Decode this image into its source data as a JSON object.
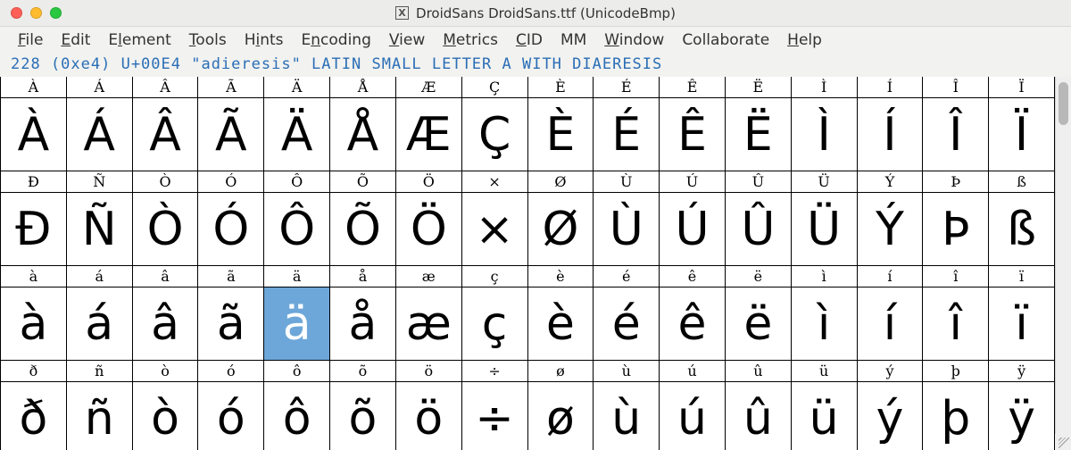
{
  "titlebar": {
    "icon_label": "X",
    "title": "DroidSans  DroidSans.ttf (UnicodeBmp)"
  },
  "menu": {
    "items": [
      {
        "label": "File",
        "u": 0
      },
      {
        "label": "Edit",
        "u": 0
      },
      {
        "label": "Element",
        "u": 1
      },
      {
        "label": "Tools",
        "u": 0
      },
      {
        "label": "Hints",
        "u": 1
      },
      {
        "label": "Encoding",
        "u": 1
      },
      {
        "label": "View",
        "u": 0
      },
      {
        "label": "Metrics",
        "u": 0
      },
      {
        "label": "CID",
        "u": 0
      },
      {
        "label": "MM",
        "u": -1
      },
      {
        "label": "Window",
        "u": 0
      },
      {
        "label": "Collaborate",
        "u": -1
      },
      {
        "label": "Help",
        "u": 0
      }
    ]
  },
  "status": "228 (0xe4) U+00E4 \"adieresis\" LATIN SMALL LETTER A WITH DIAERESIS",
  "glyph_rows": [
    {
      "labels": [
        "À",
        "Á",
        "Â",
        "Ã",
        "Ä",
        "Å",
        "Æ",
        "Ç",
        "È",
        "É",
        "Ê",
        "Ë",
        "Ì",
        "Í",
        "Î",
        "Ï"
      ],
      "glyphs": [
        "À",
        "Á",
        "Â",
        "Ã",
        "Ä",
        "Å",
        "Æ",
        "Ç",
        "È",
        "É",
        "Ê",
        "Ë",
        "Ì",
        "Í",
        "Î",
        "Ï"
      ]
    },
    {
      "labels": [
        "Ð",
        "Ñ",
        "Ò",
        "Ó",
        "Ô",
        "Õ",
        "Ö",
        "×",
        "Ø",
        "Ù",
        "Ú",
        "Û",
        "Ü",
        "Ý",
        "Þ",
        "ß"
      ],
      "glyphs": [
        "Ð",
        "Ñ",
        "Ò",
        "Ó",
        "Ô",
        "Õ",
        "Ö",
        "×",
        "Ø",
        "Ù",
        "Ú",
        "Û",
        "Ü",
        "Ý",
        "Þ",
        "ß"
      ]
    },
    {
      "labels": [
        "à",
        "á",
        "â",
        "ã",
        "ä",
        "å",
        "æ",
        "ç",
        "è",
        "é",
        "ê",
        "ë",
        "ì",
        "í",
        "î",
        "ï"
      ],
      "glyphs": [
        "à",
        "á",
        "â",
        "ã",
        "ä",
        "å",
        "æ",
        "ç",
        "è",
        "é",
        "ê",
        "ë",
        "ì",
        "í",
        "î",
        "ï"
      ],
      "selected": 4
    },
    {
      "labels": [
        "ð",
        "ñ",
        "ò",
        "ó",
        "ô",
        "õ",
        "ö",
        "÷",
        "ø",
        "ù",
        "ú",
        "û",
        "ü",
        "ý",
        "þ",
        "ÿ"
      ],
      "glyphs": [
        "ð",
        "ñ",
        "ò",
        "ó",
        "ô",
        "õ",
        "ö",
        "÷",
        "ø",
        "ù",
        "ú",
        "û",
        "ü",
        "ý",
        "þ",
        "ÿ"
      ]
    }
  ],
  "colors": {
    "selection": "#6da7d9",
    "status_text": "#2a6eb6"
  }
}
